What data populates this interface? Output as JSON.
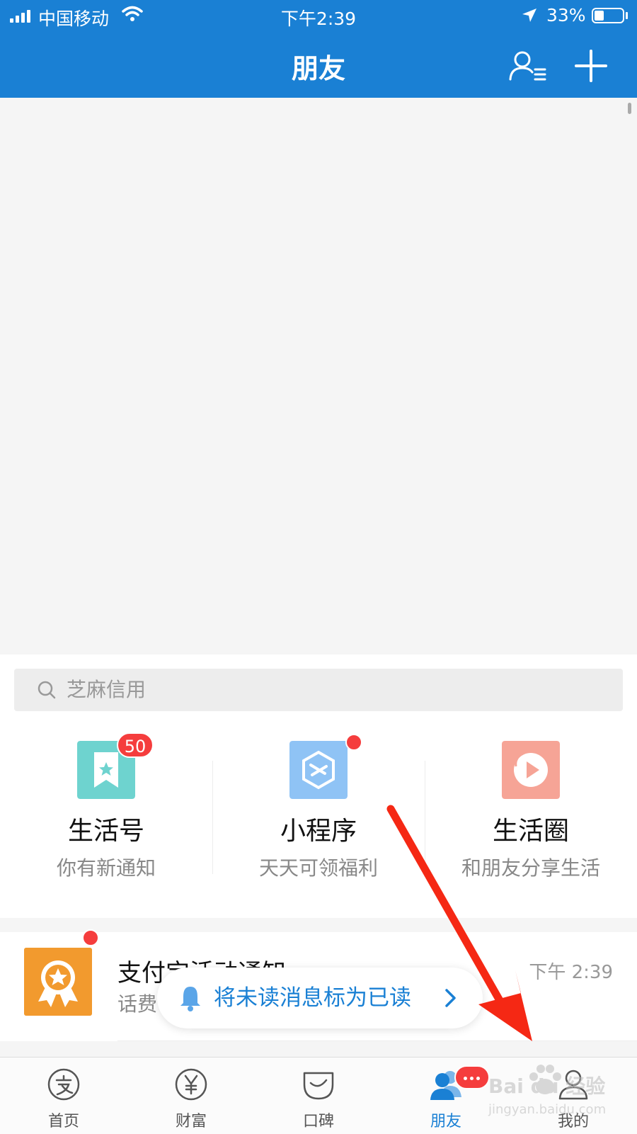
{
  "status_bar": {
    "carrier": "中国移动",
    "time": "下午2:39",
    "battery_percent_label": "33%",
    "battery_level": 0.33
  },
  "nav": {
    "title": "朋友",
    "contacts_icon": "contacts-list-icon",
    "add_icon": "plus-icon"
  },
  "search": {
    "placeholder": "芝麻信用",
    "icon": "search-icon"
  },
  "tiles": [
    {
      "title": "生活号",
      "subtitle": "你有新通知",
      "badge": "50",
      "icon": "bookmark-star-icon",
      "color": "#6ed3cf"
    },
    {
      "title": "小程序",
      "subtitle": "天天可领福利",
      "icon": "mini-program-icon",
      "color": "#8fc3f5"
    },
    {
      "title": "生活圈",
      "subtitle": "和朋友分享生活",
      "icon": "play-circle-icon",
      "color": "#f6a496"
    }
  ],
  "message": {
    "title": "支付宝活动通知",
    "subtitle": "话费",
    "time": "下午 2:39",
    "icon": "award-medal-icon",
    "color": "#f29a2e"
  },
  "toast": {
    "label": "将未读消息标为已读",
    "icon": "bell-icon"
  },
  "tabbar": {
    "tabs": [
      {
        "label": "首页",
        "icon": "alipay-home-icon"
      },
      {
        "label": "财富",
        "icon": "yuan-icon"
      },
      {
        "label": "口碑",
        "icon": "koubei-smile-icon"
      },
      {
        "label": "朋友",
        "icon": "friends-icon",
        "active": true
      },
      {
        "label": "我的",
        "icon": "person-icon"
      }
    ]
  },
  "watermark": {
    "brand": "Bai du 经验",
    "url": "jingyan.baidu.com"
  },
  "colors": {
    "brand_blue": "#1a80d4",
    "badge_red": "#f53d3d",
    "annotation_arrow": "#f52814"
  }
}
